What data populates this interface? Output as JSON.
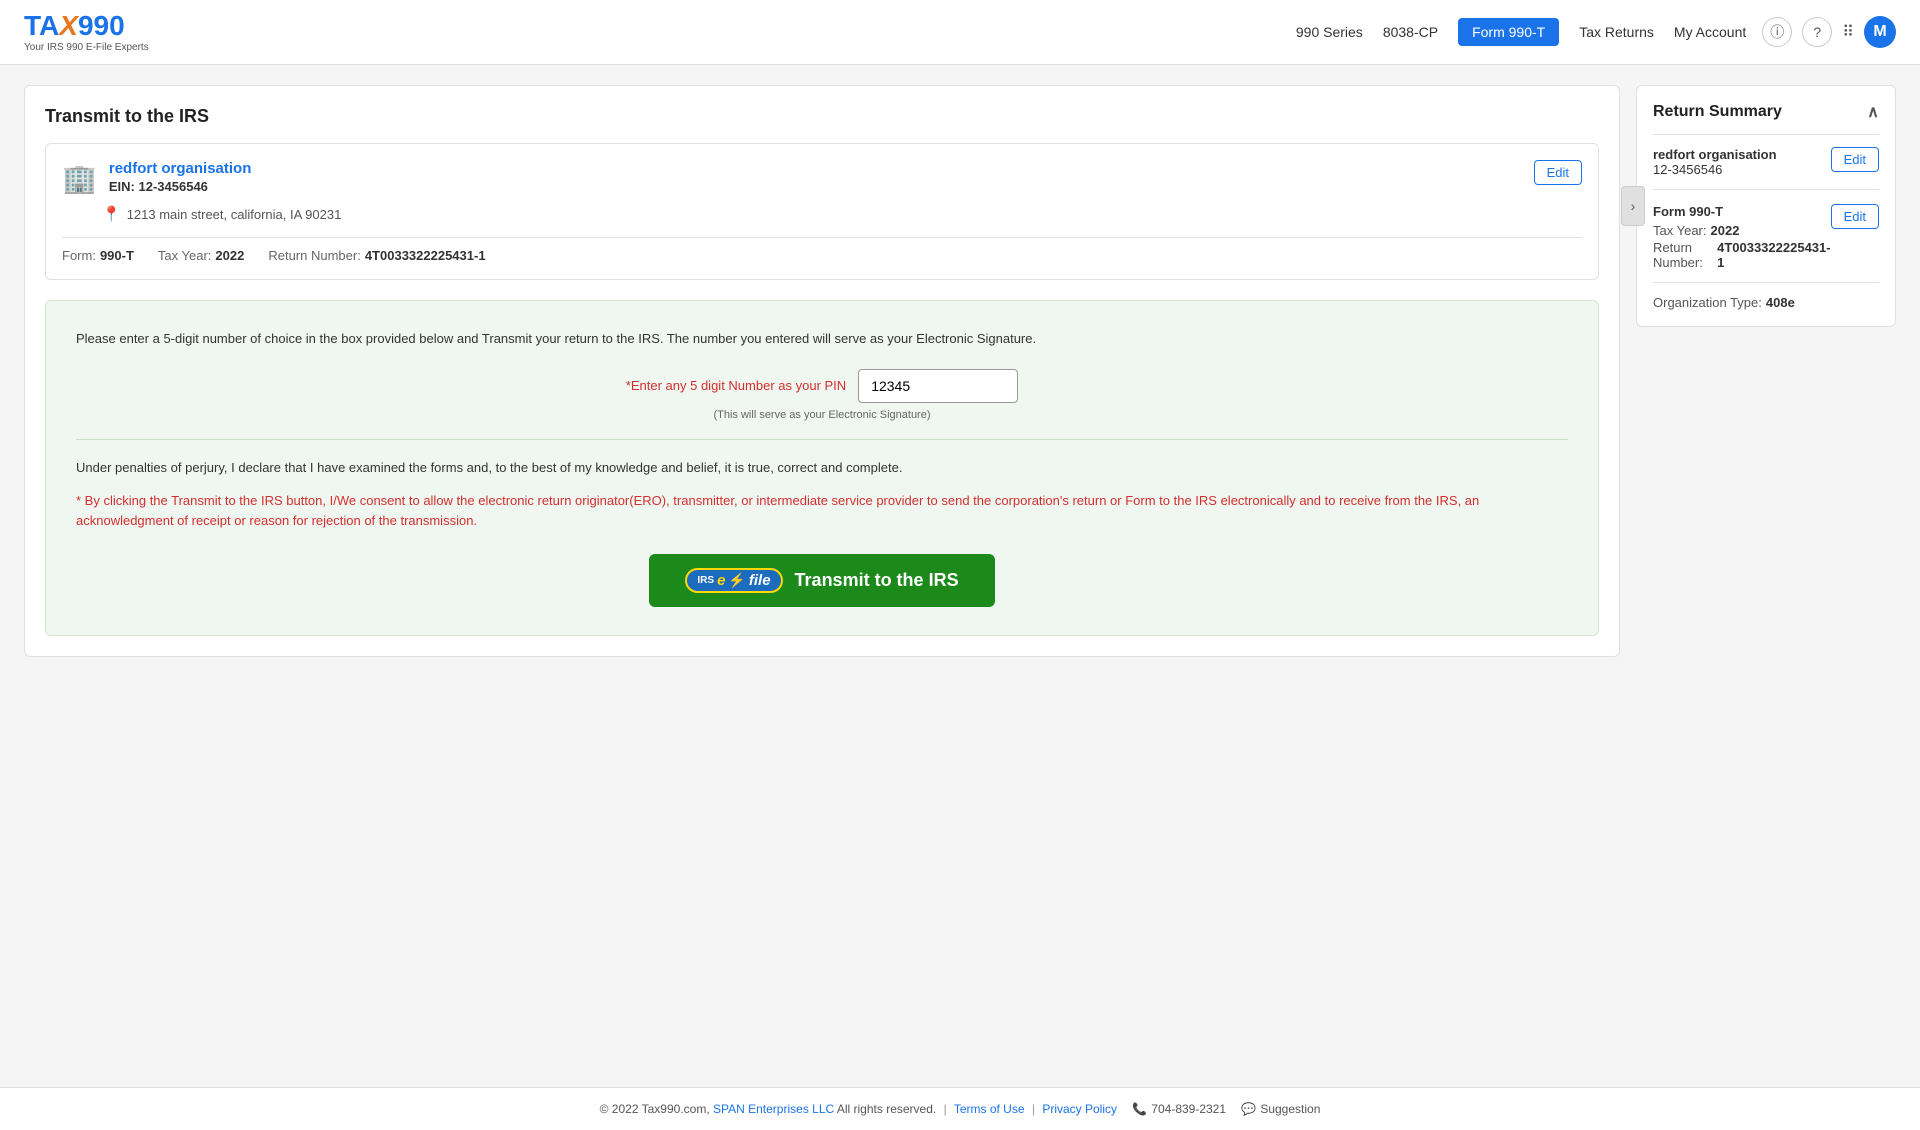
{
  "header": {
    "logo_tax": "TAX",
    "logo_990": "990",
    "tagline": "Your IRS 990 E-File Experts",
    "nav": {
      "series990": "990 Series",
      "form8038cp": "8038-CP",
      "form990t": "Form 990-T",
      "taxReturns": "Tax Returns",
      "myAccount": "My Account"
    },
    "avatar_letter": "M"
  },
  "page": {
    "title": "Transmit to the IRS",
    "org": {
      "name": "redfort organisation",
      "ein_label": "EIN:",
      "ein": "12-3456546",
      "address": "1213 main street, california, IA 90231",
      "form_label": "Form:",
      "form": "990-T",
      "tax_year_label": "Tax Year:",
      "tax_year": "2022",
      "return_number_label": "Return Number:",
      "return_number": "4T0033322225431-1",
      "edit_label": "Edit"
    },
    "pin_section": {
      "instruction": "Please enter a 5-digit number of choice in the box provided below and Transmit your return to the IRS. The number you entered will serve as your Electronic Signature.",
      "pin_label": "*Enter any 5 digit Number as your PIN",
      "pin_value": "12345",
      "pin_hint": "(This will serve as your Electronic Signature)",
      "perjury_text": "Under penalties of perjury, I declare that I have examined the forms and, to the best of my knowledge and belief, it is true, correct and complete.",
      "consent_asterisk": "*",
      "consent_text": " By clicking the Transmit to the IRS button, I/We consent to allow the electronic return originator(ERO), transmitter, or intermediate service provider to send the corporation's return or Form to the IRS electronically and to receive from the IRS, an acknowledgment of receipt or reason for rejection of the transmission.",
      "transmit_label": "Transmit to the IRS",
      "efile_irs": "IRS",
      "efile_e": "e",
      "efile_file": "file"
    }
  },
  "sidebar": {
    "title": "Return Summary",
    "org_name": "redfort organisation",
    "ein": "12-3456546",
    "form_name": "Form 990-T",
    "tax_year_label": "Tax Year:",
    "tax_year": "2022",
    "return_number_label": "Return Number:",
    "return_number": "4T0033322225431-1",
    "org_type_label": "Organization Type:",
    "org_type": "408e",
    "edit_label": "Edit",
    "edit_label2": "Edit"
  },
  "footer": {
    "copyright": "© 2022 Tax990.com,",
    "span_enterprises": "SPAN Enterprises LLC",
    "rights": "All rights reserved.",
    "terms": "Terms of Use",
    "privacy": "Privacy Policy",
    "phone": "704-839-2321",
    "suggestion": "Suggestion"
  }
}
